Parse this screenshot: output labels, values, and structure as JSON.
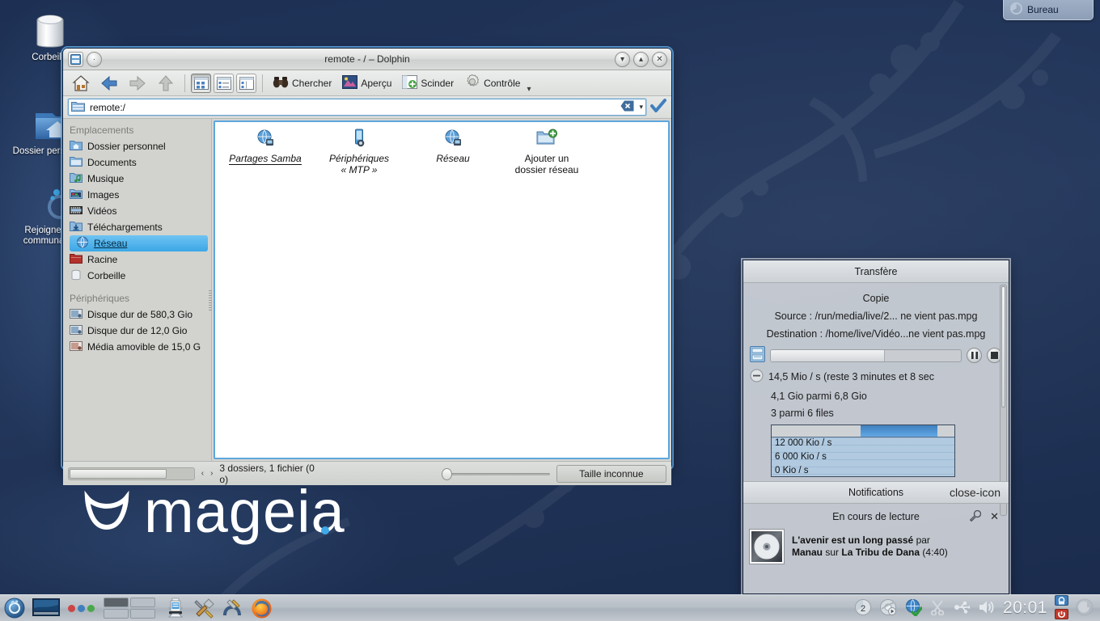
{
  "desktop": {
    "background_color": "#22355a",
    "icons": [
      {
        "name": "trash",
        "label": "Corbeille",
        "icon": "trash-icon"
      },
      {
        "name": "home-folder",
        "label": "Dossier personnel",
        "icon": "home-folder-icon"
      },
      {
        "name": "community",
        "label": "Rejoignez la communauté",
        "icon": "mageia-community-icon"
      }
    ],
    "logo_text": "mageia",
    "bureau_widget": {
      "label": "Bureau",
      "icon": "desktop-pager-icon"
    }
  },
  "dolphin": {
    "title": "remote - / – Dolphin",
    "titlebar_icons": {
      "menu": "dolphin-icon",
      "help": "help-icon"
    },
    "window_buttons": {
      "minimize": "▾",
      "maximize": "▴",
      "close": "✕"
    },
    "toolbar": {
      "home": "home-icon",
      "back": "back-arrow-icon",
      "forward": "forward-arrow-icon",
      "up": "up-arrow-icon",
      "view_icons": "view-icons-icon",
      "view_details": "view-details-icon",
      "view_columns": "view-columns-icon",
      "search_label": "Chercher",
      "preview_label": "Aperçu",
      "split_label": "Scinder",
      "control_label": "Contrôle",
      "control_arrow": "chevron-down-icon"
    },
    "urlbar": {
      "value": "remote:/",
      "icon": "folder-remote-icon",
      "clear_icon": "clear-icon",
      "dropdown_icon": "chevron-down-icon",
      "confirm_icon": "check-icon"
    },
    "sidebar": {
      "places_header": "Emplacements",
      "devices_header": "Périphériques",
      "places": [
        {
          "label": "Dossier personnel",
          "icon": "home-folder-icon",
          "selected": false
        },
        {
          "label": "Documents",
          "icon": "documents-folder-icon",
          "selected": false
        },
        {
          "label": "Musique",
          "icon": "music-folder-icon",
          "selected": false
        },
        {
          "label": "Images",
          "icon": "pictures-folder-icon",
          "selected": false
        },
        {
          "label": "Vidéos",
          "icon": "videos-folder-icon",
          "selected": false
        },
        {
          "label": "Téléchargements",
          "icon": "downloads-folder-icon",
          "selected": false
        },
        {
          "label": "Réseau",
          "icon": "network-icon",
          "selected": true
        },
        {
          "label": "Racine",
          "icon": "root-folder-icon",
          "selected": false
        },
        {
          "label": "Corbeille",
          "icon": "trash-icon",
          "selected": false
        }
      ],
      "devices": [
        {
          "label": "Disque dur de 580,3 Gio",
          "icon": "harddisk-icon"
        },
        {
          "label": "Disque dur de 12,0 Gio",
          "icon": "harddisk-icon"
        },
        {
          "label": "Média amovible de 15,0 G",
          "icon": "removable-media-icon"
        }
      ]
    },
    "files": [
      {
        "label": "Partages Samba",
        "icon": "network-globe-icon",
        "link": true,
        "underlined": true
      },
      {
        "label": "Périphériques\n« MTP »",
        "line1": "Périphériques",
        "line2": "« MTP »",
        "icon": "mtp-device-icon",
        "link": true
      },
      {
        "label": "Réseau",
        "line1": "Réseau",
        "line2": "",
        "icon": "network-globe-icon",
        "link": true
      },
      {
        "label": "Ajouter un dossier réseau",
        "line1": "Ajouter un",
        "line2": "dossier réseau",
        "icon": "add-folder-icon",
        "link": false
      }
    ],
    "statusbar": {
      "info": "3 dossiers, 1 fichier (0 o)",
      "size_button": "Taille inconnue",
      "zoom_value": 0
    }
  },
  "transfer_panel": {
    "title": "Transfère",
    "operation": "Copie",
    "source": "Source : /run/media/live/2... ne vient pas.mpg",
    "destination": "Destination : /home/live/Vidéo...ne vient pas.mpg",
    "progress_percent": 60,
    "pause_icon": "pause-icon",
    "stop_icon": "stop-icon",
    "collapse_icon": "minus-circle-icon",
    "copy_icon": "file-copy-icon",
    "speed_line": "14,5 Mio / s (reste 3 minutes et 8 sec",
    "bytes_line": "4,1 Gio parmi 6,8 Gio",
    "files_line": "3 parmi 6 files",
    "graph": {
      "labels": [
        "12 000 Kio / s",
        "6 000 Kio / s",
        "0 Kio / s"
      ],
      "current_bar_percent": 42
    }
  },
  "notifications": {
    "title": "Notifications",
    "close_icon": "close-icon",
    "section_title": "En cours de lecture",
    "config_icon": "wrench-icon",
    "item_close_icon": "close-icon",
    "album_art_icon": "cd-icon",
    "track": "L'avenir est un long passé",
    "by_word": "par",
    "artist": "Manau",
    "on_word": "sur",
    "album": "La Tribu de Dana",
    "duration": "(4:40)"
  },
  "taskbar": {
    "launchers": [
      {
        "name": "kickoff-menu",
        "icon": "mageia-menu-icon"
      },
      {
        "name": "show-desktop",
        "icon": "show-desktop-icon"
      },
      {
        "name": "activities",
        "icon": "activities-dots-icon"
      }
    ],
    "pager": {
      "desktops": 4,
      "active": 1
    },
    "windows": [
      {
        "name": "dolphin-task",
        "icon": "dolphin-icon"
      }
    ],
    "tray_launchers": [
      {
        "name": "config-tools",
        "icon": "tools-icon"
      },
      {
        "name": "network-center",
        "icon": "network-tools-icon"
      },
      {
        "name": "firefox",
        "icon": "firefox-icon"
      }
    ],
    "tray": [
      {
        "name": "desktop-number",
        "icon": "pager-number-icon",
        "label": "2"
      },
      {
        "name": "media-player",
        "icon": "media-player-icon"
      },
      {
        "name": "network-status",
        "icon": "network-globe-icon"
      },
      {
        "name": "klipper",
        "icon": "scissors-icon"
      },
      {
        "name": "device-notifier",
        "icon": "usb-icon"
      },
      {
        "name": "volume",
        "icon": "speaker-icon"
      }
    ],
    "clock": "20:01",
    "lock_icon": "lock-icon",
    "shutdown_icon": "power-icon",
    "cashew_icon": "cashew-icon"
  }
}
